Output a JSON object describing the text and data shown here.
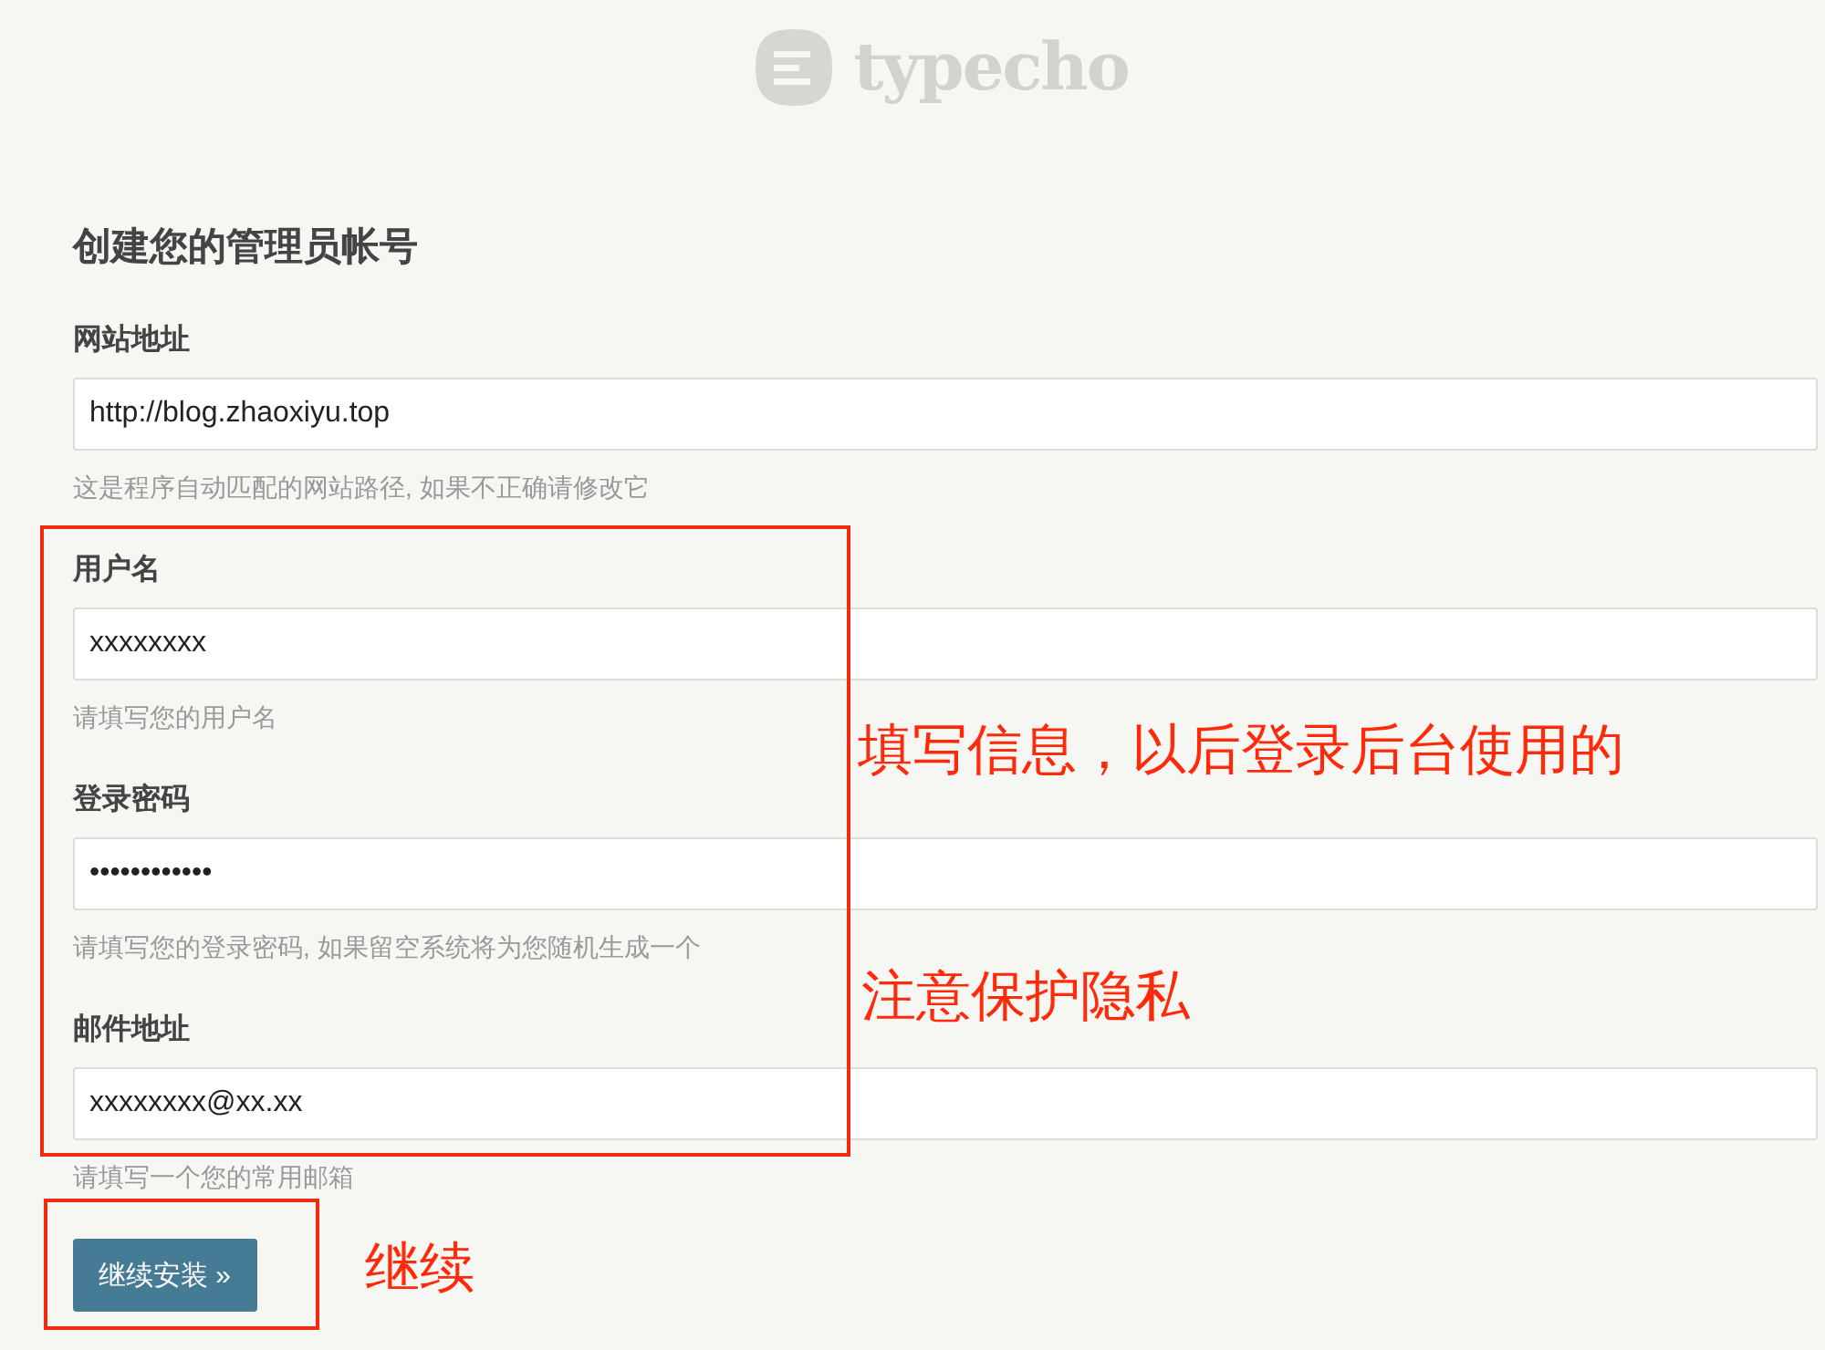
{
  "logo": {
    "text": "typecho"
  },
  "heading": "创建您的管理员帐号",
  "fields": [
    {
      "label": "网站地址",
      "value": "http://blog.zhaoxiyu.top",
      "hint": "这是程序自动匹配的网站路径, 如果不正确请修改它"
    },
    {
      "label": "用户名",
      "value": "xxxxxxxx",
      "hint": "请填写您的用户名"
    },
    {
      "label": "登录密码",
      "value": "••••••••••••",
      "hint": "请填写您的登录密码, 如果留空系统将为您随机生成一个"
    },
    {
      "label": "邮件地址",
      "value": "xxxxxxxx@xx.xx",
      "hint": "请填写一个您的常用邮箱"
    }
  ],
  "button": "继续安装 »",
  "annotations": [
    {
      "text": "填写信息，以后登录后台使用的"
    },
    {
      "text": "注意保护隐私"
    },
    {
      "text": "继续"
    }
  ]
}
